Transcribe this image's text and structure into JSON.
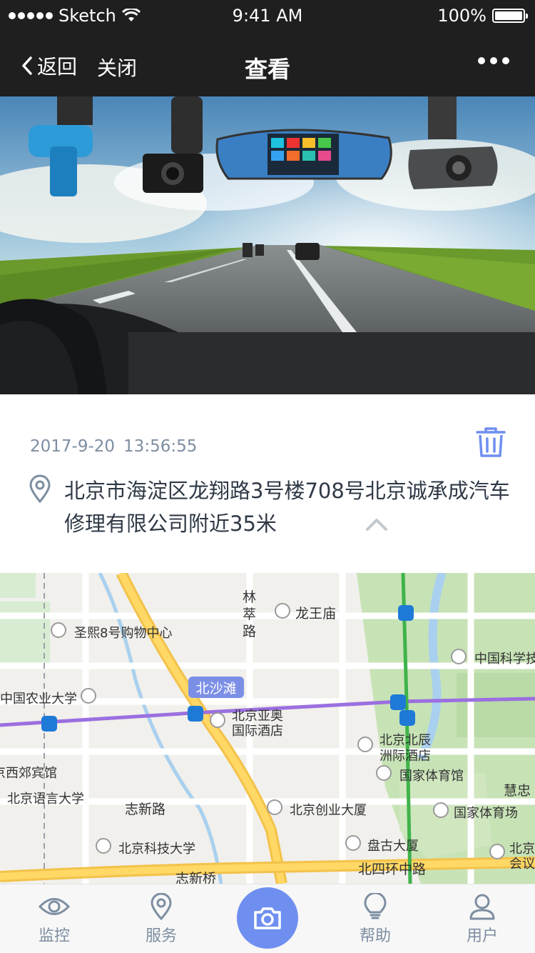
{
  "status_bar": {
    "carrier": "Sketch",
    "time": "9:41 AM",
    "battery": "100%"
  },
  "nav": {
    "back_label": "返回",
    "close_label": "关闭",
    "title": "查看"
  },
  "record": {
    "date": "2017-9-20",
    "time": "13:56:55",
    "address": "北京市海淀区龙翔路3号楼708号北京诚承成汽车修理有限公司附近35米"
  },
  "map": {
    "labels": {
      "linchui_road": "林萃路",
      "longwang_temple": "龙王庙",
      "shengxi_mall": "圣熙8号购物中心",
      "cas": "中国科学技",
      "beishatan": "北沙滩",
      "cau": "中国农业大学",
      "beijing_yaao": "北京亚奥",
      "intl_hotel": "国际酒店",
      "beichen_1": "北京北辰",
      "beichen_2": "洲际酒店",
      "xijiao_hotel": "京西郊宾馆",
      "blcu": "北京语言大学",
      "zhixin_road": "志新路",
      "chuangye": "北京创业大厦",
      "gym_hall": "国家体育馆",
      "huizhong": "慧忠",
      "stadium": "国家体育场",
      "ustb": "北京科技大学",
      "pangu": "盘古大厦",
      "beijing_conf": "北京",
      "conf_2": "会议",
      "zhixin_bridge": "志新桥",
      "north4ring": "北四环中路"
    }
  },
  "tabs": {
    "watch": "监控",
    "service": "服务",
    "help": "帮助",
    "user": "用户"
  },
  "colors": {
    "accent": "#6f8ff0",
    "muted": "#7d8ea1",
    "text": "#2f3946",
    "navbar": "#1f1f1f"
  }
}
